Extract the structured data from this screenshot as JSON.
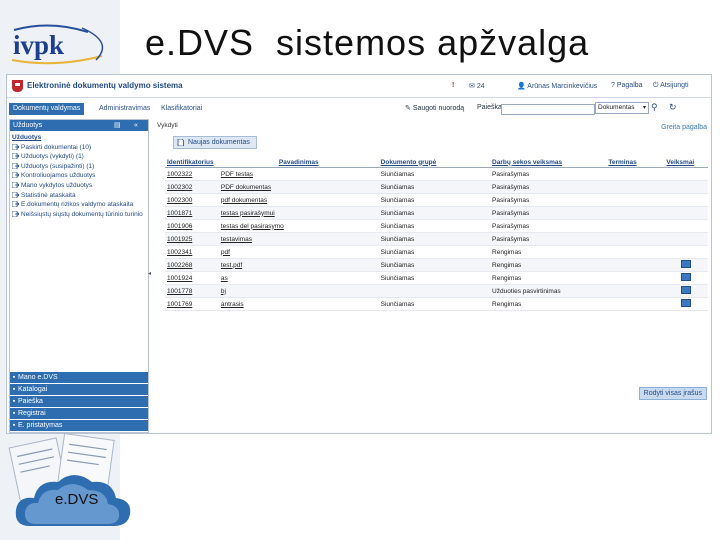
{
  "slide": {
    "title": "e.DVS  sistemos apžvalga",
    "logo_text": "ivpk",
    "cloud_label": "e.DVS"
  },
  "app": {
    "title": "Elektroninė dokumentų valdymo sistema",
    "header_items": [
      "24",
      "Arūnas Marcinkevičius",
      "Pagalba",
      "Atsijungti"
    ],
    "nav_tabs": [
      "Dokumentų valdymas",
      "Administravimas",
      "Klasifikatoriai"
    ],
    "nav_right": {
      "save": "Saugoti nuorodą",
      "search_label": "Paieška"
    },
    "search": {
      "value": ""
    },
    "select": {
      "value": "Dokumentas"
    }
  },
  "sidebar": {
    "header": "Užduotys",
    "items": [
      "Užduotys",
      "Paskirti dokumentai (10)",
      "Užduotys (vykdyti) (1)",
      "Užduotys (susipažinti) (1)",
      "Kontroliuojamos užduotys",
      "Mano vykdytos užduotys",
      "Statistinė ataskaita",
      "E.dokumentų rizikos valdymo ataskaita",
      "Neišsiųstų siųstų dokumentų tūrinio turinio"
    ],
    "sections": [
      "Mano e.DVS",
      "Katalogai",
      "Paieška",
      "Registrai",
      "E. pristatymas"
    ]
  },
  "main": {
    "tab_label": "Vykdyti",
    "help_link": "Greita pagalba",
    "new_doc_button": "Naujas dokumentas",
    "columns": [
      "Identifikatorius",
      "Pavadinimas",
      "Dokumento grupė",
      "Darbų sekos veiksmas",
      "Terminas",
      "Veiksmai"
    ],
    "rows": [
      {
        "id": "1002322",
        "name": "PDF testas",
        "group": "Siunčiamas",
        "step": "Pasirašymas",
        "due": "",
        "action": false
      },
      {
        "id": "1002302",
        "name": "PDF dokumentas",
        "group": "Siunčiamas",
        "step": "Pasirašymas",
        "due": "",
        "action": false
      },
      {
        "id": "1002300",
        "name": "pdf dokumentas",
        "group": "Siunčiamas",
        "step": "Pasirašymas",
        "due": "",
        "action": false
      },
      {
        "id": "1001871",
        "name": "testas pasirašymui",
        "group": "Siunčiamas",
        "step": "Pasirašymas",
        "due": "",
        "action": false
      },
      {
        "id": "1001906",
        "name": "testas del pasirasymo",
        "group": "Siunčiamas",
        "step": "Pasirašymas",
        "due": "",
        "action": false
      },
      {
        "id": "1001925",
        "name": "testavimas",
        "group": "Siunčiamas",
        "step": "Pasirašymas",
        "due": "",
        "action": false
      },
      {
        "id": "1002341",
        "name": "pdf",
        "group": "Siunčiamas",
        "step": "Rengimas",
        "due": "",
        "action": false
      },
      {
        "id": "1002268",
        "name": "test.pdf",
        "group": "Siunčiamas",
        "step": "Rengimas",
        "due": "",
        "action": true
      },
      {
        "id": "1001924",
        "name": "as",
        "group": "Siunčiamas",
        "step": "Rengimas",
        "due": "",
        "action": true
      },
      {
        "id": "1001778",
        "name": "bj",
        "group": "",
        "step": "Užduoties pasvirtinimas",
        "due": "",
        "action": true
      },
      {
        "id": "1001769",
        "name": "antrasis",
        "group": "Siunčiamas",
        "step": "Rengimas",
        "due": "",
        "action": true
      }
    ],
    "all_button": "Rodyti visas įrašus"
  },
  "colors": {
    "accent": "#2d6db0",
    "brand": "#1d3f8f",
    "header_link": "#234a86"
  }
}
